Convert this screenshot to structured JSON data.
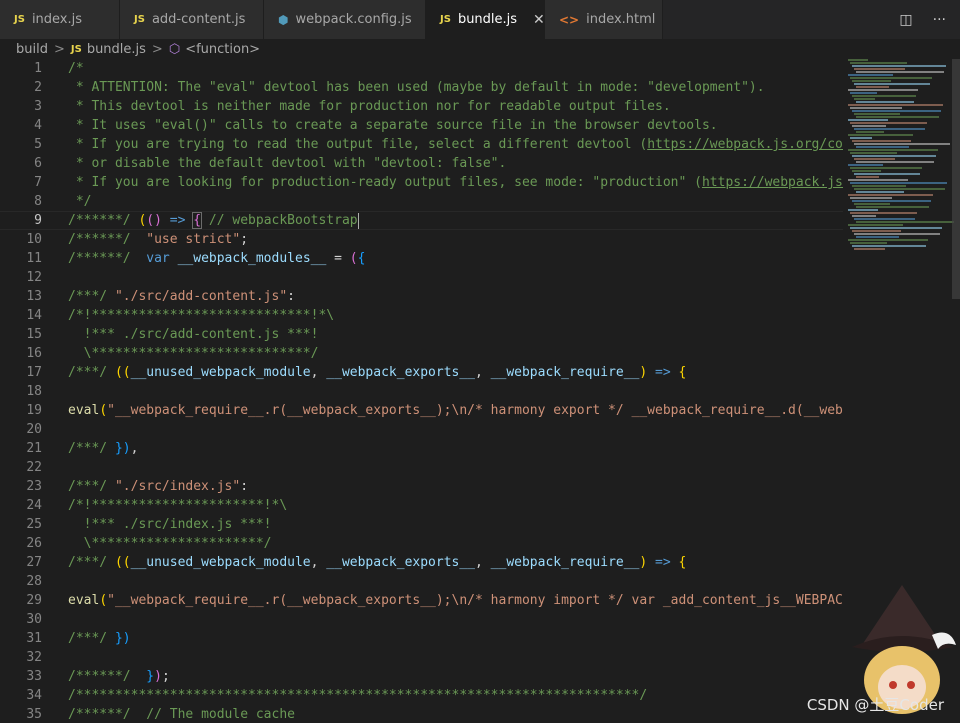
{
  "tabs": [
    {
      "label": "index.js",
      "icon": "js-file-icon",
      "glyph": "JS",
      "active": false
    },
    {
      "label": "add-content.js",
      "icon": "js-file-icon",
      "glyph": "JS",
      "active": false
    },
    {
      "label": "webpack.config.js",
      "icon": "webpack-config-icon",
      "glyph": "⬢",
      "active": false
    },
    {
      "label": "bundle.js",
      "icon": "js-file-icon",
      "glyph": "JS",
      "active": true
    },
    {
      "label": "index.html",
      "icon": "html-file-icon",
      "glyph": "<>",
      "active": false
    }
  ],
  "tab_close_glyph": "✕",
  "actions": {
    "split": "◫",
    "more": "···"
  },
  "breadcrumb": {
    "folder": "build",
    "file": "bundle.js",
    "file_glyph": "JS",
    "symbol": "<function>",
    "sep": ">"
  },
  "watermark": "CSDN @土豆Coder",
  "lines": [
    {
      "n": "1",
      "t": [
        [
          "c",
          "/*"
        ]
      ]
    },
    {
      "n": "2",
      "t": [
        [
          "c",
          " * ATTENTION: The \"eval\" devtool has been used (maybe by default in mode: \"development\")."
        ]
      ]
    },
    {
      "n": "3",
      "t": [
        [
          "c",
          " * This devtool is neither made for production nor for readable output files."
        ]
      ]
    },
    {
      "n": "4",
      "t": [
        [
          "c",
          " * It uses \"eval()\" calls to create a separate source file in the browser devtools."
        ]
      ]
    },
    {
      "n": "5",
      "t": [
        [
          "c",
          " * If you are trying to read the output file, select a different devtool ("
        ],
        [
          "c u",
          "https://webpack.js.org/conf"
        ]
      ]
    },
    {
      "n": "6",
      "t": [
        [
          "c",
          " * or disable the default devtool with \"devtool: false\"."
        ]
      ]
    },
    {
      "n": "7",
      "t": [
        [
          "c",
          " * If you are looking for production-ready output files, see mode: \"production\" ("
        ],
        [
          "c u",
          "https://webpack.js.c"
        ]
      ]
    },
    {
      "n": "8",
      "t": [
        [
          "c",
          " */"
        ]
      ]
    },
    {
      "n": "9",
      "t": [
        [
          "c",
          "/******/ "
        ],
        [
          "b1",
          "("
        ],
        [
          "b2",
          "()"
        ],
        [
          "p",
          " "
        ],
        [
          "k",
          "=>"
        ],
        [
          "p",
          " "
        ],
        [
          "b2 hl",
          "{"
        ],
        [
          "p",
          " "
        ],
        [
          "c",
          "// webpackBootstrap"
        ]
      ],
      "current": true
    },
    {
      "n": "10",
      "t": [
        [
          "c",
          "/******/ "
        ],
        [
          "p",
          " "
        ],
        [
          "s",
          "\"use strict\""
        ],
        [
          "p",
          ";"
        ]
      ]
    },
    {
      "n": "11",
      "t": [
        [
          "c",
          "/******/ "
        ],
        [
          "p",
          " "
        ],
        [
          "k",
          "var"
        ],
        [
          "p",
          " "
        ],
        [
          "v",
          "__webpack_modules__"
        ],
        [
          "p",
          " = "
        ],
        [
          "b2",
          "("
        ],
        [
          "b3",
          "{"
        ]
      ]
    },
    {
      "n": "12",
      "t": []
    },
    {
      "n": "13",
      "t": [
        [
          "c",
          "/***/ "
        ],
        [
          "s",
          "\"./src/add-content.js\""
        ],
        [
          "p",
          ":"
        ]
      ]
    },
    {
      "n": "14",
      "t": [
        [
          "c",
          "/*!****************************!*\\"
        ]
      ]
    },
    {
      "n": "15",
      "t": [
        [
          "c",
          "  !*** ./src/add-content.js ***!"
        ]
      ]
    },
    {
      "n": "16",
      "t": [
        [
          "c",
          "  \\****************************/"
        ]
      ]
    },
    {
      "n": "17",
      "t": [
        [
          "c",
          "/***/ "
        ],
        [
          "b1",
          "(("
        ],
        [
          "v",
          "__unused_webpack_module"
        ],
        [
          "p",
          ", "
        ],
        [
          "v",
          "__webpack_exports__"
        ],
        [
          "p",
          ", "
        ],
        [
          "v",
          "__webpack_require__"
        ],
        [
          "b1",
          ")"
        ],
        [
          "p",
          " "
        ],
        [
          "k",
          "=>"
        ],
        [
          "p",
          " "
        ],
        [
          "b1",
          "{"
        ]
      ]
    },
    {
      "n": "18",
      "t": []
    },
    {
      "n": "19",
      "t": [
        [
          "f",
          "eval"
        ],
        [
          "b1",
          "("
        ],
        [
          "s",
          "\"__webpack_require__.r(__webpack_exports__);\\n/* harmony export */ __webpack_require__.d(__webpa"
        ]
      ]
    },
    {
      "n": "20",
      "t": []
    },
    {
      "n": "21",
      "t": [
        [
          "c",
          "/***/ "
        ],
        [
          "b3",
          "})"
        ],
        [
          "p",
          ","
        ]
      ]
    },
    {
      "n": "22",
      "t": []
    },
    {
      "n": "23",
      "t": [
        [
          "c",
          "/***/ "
        ],
        [
          "s",
          "\"./src/index.js\""
        ],
        [
          "p",
          ":"
        ]
      ]
    },
    {
      "n": "24",
      "t": [
        [
          "c",
          "/*!**********************!*\\"
        ]
      ]
    },
    {
      "n": "25",
      "t": [
        [
          "c",
          "  !*** ./src/index.js ***!"
        ]
      ]
    },
    {
      "n": "26",
      "t": [
        [
          "c",
          "  \\**********************/"
        ]
      ]
    },
    {
      "n": "27",
      "t": [
        [
          "c",
          "/***/ "
        ],
        [
          "b1",
          "(("
        ],
        [
          "v",
          "__unused_webpack_module"
        ],
        [
          "p",
          ", "
        ],
        [
          "v",
          "__webpack_exports__"
        ],
        [
          "p",
          ", "
        ],
        [
          "v",
          "__webpack_require__"
        ],
        [
          "b1",
          ")"
        ],
        [
          "p",
          " "
        ],
        [
          "k",
          "=>"
        ],
        [
          "p",
          " "
        ],
        [
          "b1",
          "{"
        ]
      ]
    },
    {
      "n": "28",
      "t": []
    },
    {
      "n": "29",
      "t": [
        [
          "f",
          "eval"
        ],
        [
          "b1",
          "("
        ],
        [
          "s",
          "\"__webpack_require__.r(__webpack_exports__);\\n/* harmony import */ var _add_content_js__WEBPACK_"
        ]
      ]
    },
    {
      "n": "30",
      "t": []
    },
    {
      "n": "31",
      "t": [
        [
          "c",
          "/***/ "
        ],
        [
          "b3",
          "})"
        ]
      ]
    },
    {
      "n": "32",
      "t": []
    },
    {
      "n": "33",
      "t": [
        [
          "c",
          "/******/ "
        ],
        [
          "p",
          " "
        ],
        [
          "b3",
          "}"
        ],
        [
          "b2",
          ")"
        ],
        [
          "p",
          ";"
        ]
      ]
    },
    {
      "n": "34",
      "t": [
        [
          "c",
          "/************************************************************************/"
        ]
      ]
    },
    {
      "n": "35",
      "t": [
        [
          "c",
          "/******/ "
        ],
        [
          "p",
          " "
        ],
        [
          "c",
          "// The module cache"
        ]
      ]
    }
  ],
  "colors": {
    "background": "#1e1e1e",
    "comment": "#6a9955",
    "string": "#ce9178",
    "keyword": "#569cd6"
  }
}
